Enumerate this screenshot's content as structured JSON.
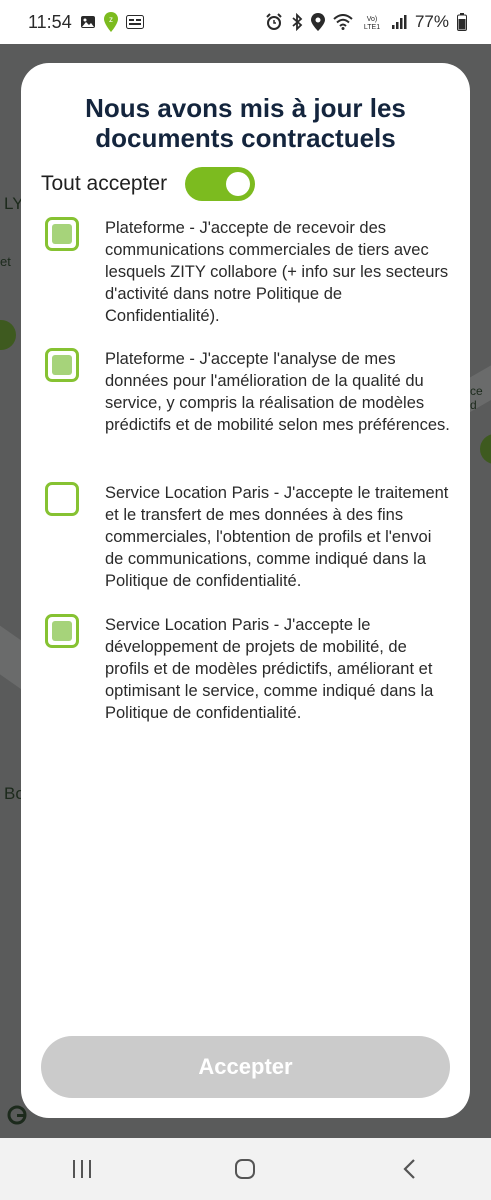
{
  "status_bar": {
    "time": "11:54",
    "battery_percent": "77%",
    "left_icons": [
      "image-icon",
      "location-pin-icon",
      "notification-box-icon"
    ],
    "right_icons": [
      "alarm-icon",
      "bluetooth-icon",
      "location-icon",
      "wifi-icon",
      "volte-icon",
      "signal-icon",
      "battery-icon"
    ],
    "volte_label": "Vo) LTE1"
  },
  "map_fragments": [
    "LY",
    "et",
    "Bo",
    "ce d"
  ],
  "modal": {
    "title_line1": "Nous avons mis à jour les",
    "title_line2": "documents contractuels",
    "toggle_all": {
      "label": "Tout accepter",
      "on": true
    },
    "consents": [
      {
        "checked": true,
        "text": "Plateforme - J'accepte de recevoir des communications commerciales de tiers avec lesquels ZITY collabore (+ info sur les secteurs d'activité dans notre Politique de Confidentialité)."
      },
      {
        "checked": true,
        "text": "Plateforme - J'accepte l'analyse de mes données pour l'amélioration de la qualité du service, y compris la réalisation de modèles prédictifs et de mobilité selon mes préférences."
      },
      {
        "checked": false,
        "text": "Service Location Paris - J'accepte le traitement et le transfert de mes données à des fins commerciales, l'obtention de profils et l'envoi de communications, comme indiqué dans la Politique de confidentialité."
      },
      {
        "checked": true,
        "text": "Service Location Paris - J'accepte le développement de projets de mobilité, de profils et de modèles prédictifs, améliorant et optimisant le service, comme indiqué dans la Politique de confidentialité."
      }
    ],
    "accept_button_label": "Accepter"
  },
  "colors": {
    "accent_green": "#7cbb1f",
    "checkbox_border": "#86c232",
    "checkbox_fill": "#a6d37a",
    "title_navy": "#14253d",
    "disabled_button": "#cbcbcb"
  },
  "nav_bar": {
    "buttons": [
      "recent-apps-icon",
      "home-icon",
      "back-icon"
    ]
  }
}
